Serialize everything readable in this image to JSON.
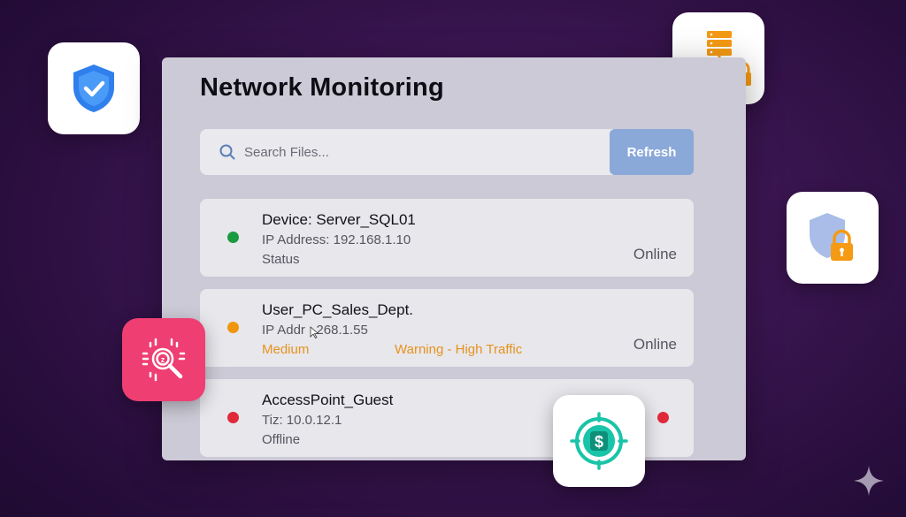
{
  "panel": {
    "title": "Network Monitoring"
  },
  "search": {
    "placeholder": "Search Files...",
    "refresh_label": "Refresh"
  },
  "devices": [
    {
      "name": "Device: Server_SQL01",
      "ip": "IP Address: 192.168.1.10",
      "line3": "Status",
      "state": "Online",
      "dot_color": "#1a9b3f"
    },
    {
      "name": "User_PC_Sales_Dept.",
      "ip": "IP Addr   268.1.55",
      "line3": "Medium",
      "warning": "Warning - High Traffic",
      "state": "Online",
      "dot_color": "#f0960e"
    },
    {
      "name": "AccessPoint_Guest",
      "ip": "Tiz: 10.0.12.1",
      "line3": "Offline",
      "dot_color": "#e02a3a",
      "right_dot_color": "#e02a3a"
    }
  ],
  "icons": {
    "shield_check": "shield-check-icon",
    "network_lock": "network-lock-icon",
    "shield_lock": "shield-lock-icon",
    "search_audit": "search-audit-icon",
    "dollar_target": "dollar-target-icon",
    "sparkle": "sparkle-icon"
  },
  "colors": {
    "accent_blue": "#8aa8d8",
    "online_green": "#1a9b3f",
    "warning_orange": "#f0960e",
    "offline_red": "#e02a3a",
    "brand_pink": "#ee3e72",
    "brand_teal": "#19c4a8"
  }
}
